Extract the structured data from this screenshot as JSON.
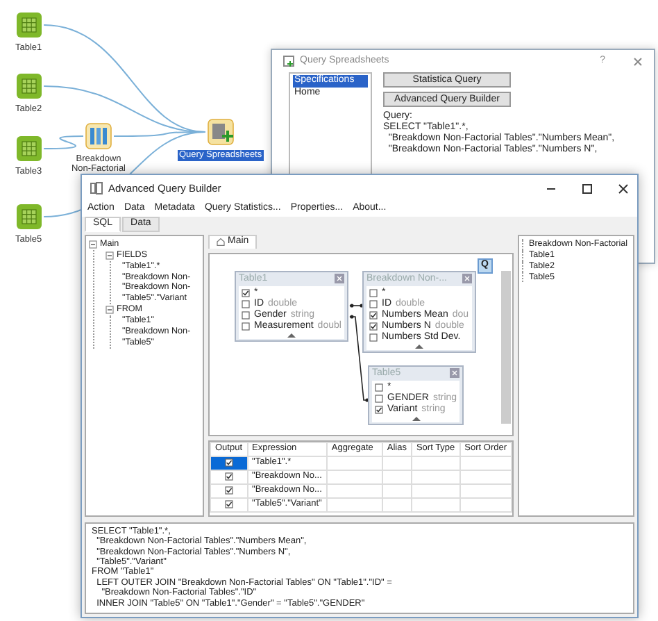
{
  "workflow": {
    "nodes": [
      {
        "label": "Table1",
        "kind": "table",
        "selected": false
      },
      {
        "label": "Table2",
        "kind": "table",
        "selected": false
      },
      {
        "label": "Table3",
        "kind": "table",
        "selected": false
      },
      {
        "label": "Breakdown Non-Factorial",
        "kind": "breakdown",
        "selected": false
      },
      {
        "label": "Table5",
        "kind": "table",
        "selected": false
      },
      {
        "label": "Query Spreadsheets",
        "kind": "query",
        "selected": true
      }
    ]
  },
  "query_dialog": {
    "title": "Query Spreadsheets",
    "help": "?",
    "nav": [
      {
        "label": "Specifications",
        "selected": true
      },
      {
        "label": "Home",
        "selected": false
      }
    ],
    "buttons": [
      "Statistica Query",
      "Advanced Query Builder"
    ],
    "query_label": "Query:",
    "query_lines": [
      "SELECT \"Table1\".*,",
      "  \"Breakdown Non-Factorial Tables\".\"Numbers Mean\",",
      "  \"Breakdown Non-Factorial Tables\".\"Numbers N\","
    ]
  },
  "builder": {
    "title": "Advanced Query Builder",
    "menu": [
      "Action",
      "Data",
      "Metadata",
      "Query Statistics...",
      "Properties...",
      "About..."
    ],
    "tabs": [
      {
        "label": "SQL",
        "selected": true
      },
      {
        "label": "Data",
        "selected": false
      }
    ],
    "query_tree": [
      {
        "label": "Main",
        "expanded": true,
        "children": [
          {
            "label": "FIELDS",
            "expanded": true,
            "children": [
              {
                "label": "\"Table1\".*"
              },
              {
                "label": "\"Breakdown Non-"
              },
              {
                "label": "\"Breakdown Non-"
              },
              {
                "label": "\"Table5\".\"Variant"
              }
            ]
          },
          {
            "label": "FROM",
            "expanded": true,
            "children": [
              {
                "label": "\"Table1\""
              },
              {
                "label": "\"Breakdown Non-"
              },
              {
                "label": "\"Table5\""
              }
            ]
          }
        ]
      }
    ],
    "canvas_tab": "Main",
    "q_button": "Q",
    "tables": [
      {
        "title": "Table1",
        "fields": [
          {
            "name": "*",
            "checked": true
          },
          {
            "name": "ID",
            "type": "double",
            "checked": false
          },
          {
            "name": "Gender",
            "type": "string",
            "checked": false
          },
          {
            "name": "Measurement",
            "type": "doubl",
            "checked": false
          }
        ]
      },
      {
        "title": "Breakdown Non-...",
        "fields": [
          {
            "name": "*",
            "checked": false
          },
          {
            "name": "ID",
            "type": "double",
            "checked": false
          },
          {
            "name": "Numbers Mean",
            "type": "dou",
            "checked": true
          },
          {
            "name": "Numbers N",
            "type": "double",
            "checked": true
          },
          {
            "name": "Numbers Std Dev.",
            "checked": false
          }
        ]
      },
      {
        "title": "Table5",
        "fields": [
          {
            "name": "*",
            "checked": false
          },
          {
            "name": "GENDER",
            "type": "string",
            "checked": false
          },
          {
            "name": "Variant",
            "type": "string",
            "checked": true
          }
        ]
      }
    ],
    "source_tree": [
      {
        "label": "Breakdown Non-Factorial"
      },
      {
        "label": "Table1"
      },
      {
        "label": "Table2"
      },
      {
        "label": "Table5"
      }
    ],
    "grid": {
      "columns": [
        "Output",
        "Expression",
        "Aggregate",
        "Alias",
        "Sort Type",
        "Sort Order"
      ],
      "rows": [
        {
          "output": true,
          "selected": true,
          "expression": "\"Table1\".*"
        },
        {
          "output": true,
          "selected": false,
          "expression": "\"Breakdown No..."
        },
        {
          "output": true,
          "selected": false,
          "expression": "\"Breakdown No..."
        },
        {
          "output": true,
          "selected": false,
          "expression": "\"Table5\".\"Variant\""
        }
      ]
    },
    "sql": [
      "SELECT \"Table1\".*,",
      "  \"Breakdown Non-Factorial Tables\".\"Numbers Mean\",",
      "  \"Breakdown Non-Factorial Tables\".\"Numbers N\",",
      "  \"Table5\".\"Variant\"",
      "FROM \"Table1\"",
      "  LEFT OUTER JOIN \"Breakdown Non-Factorial Tables\" ON \"Table1\".\"ID\" =",
      "    \"Breakdown Non-Factorial Tables\".\"ID\"",
      "  INNER JOIN \"Table5\" ON \"Table1\".\"Gender\" = \"Table5\".\"GENDER\""
    ]
  }
}
